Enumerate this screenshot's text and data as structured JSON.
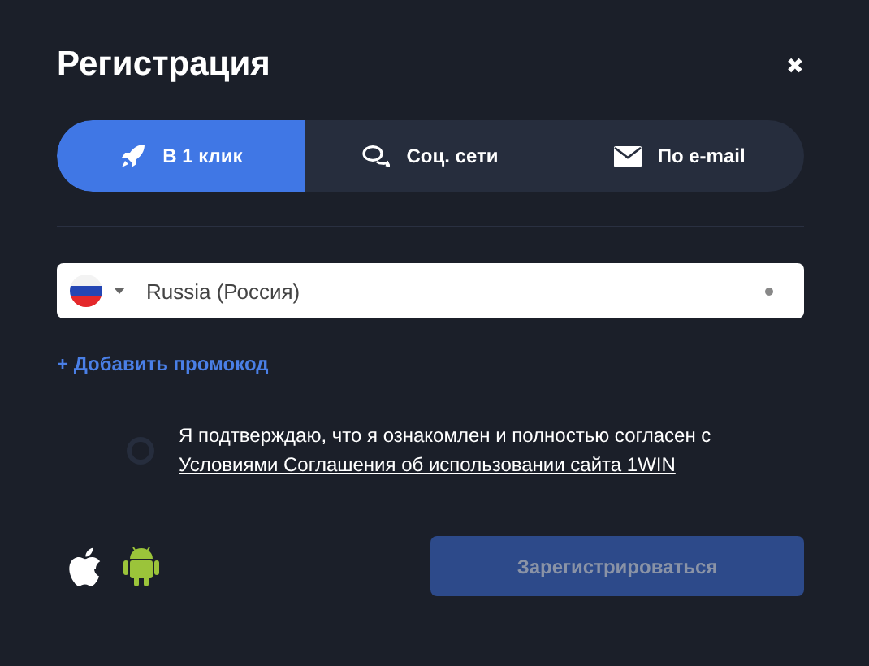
{
  "dialog": {
    "title": "Регистрация",
    "close": "✖"
  },
  "tabs": [
    {
      "label": "В 1 клик",
      "kind": "rocket",
      "selected": true
    },
    {
      "label": "Соц. сети",
      "kind": "chat",
      "selected": false
    },
    {
      "label": "По e-mail",
      "kind": "mail",
      "selected": false
    }
  ],
  "country_field": {
    "value": "Russia (Россия)"
  },
  "promo_link": "+ Добавить промокод",
  "agreement": {
    "checked": false,
    "text": "Я подтверждаю, что я ознакомлен и полностью согласен с",
    "link": "Условиями Соглашения об использовании сайта 1WIN"
  },
  "register_button": {
    "label": "Зарегистрироваться",
    "disabled": true
  }
}
